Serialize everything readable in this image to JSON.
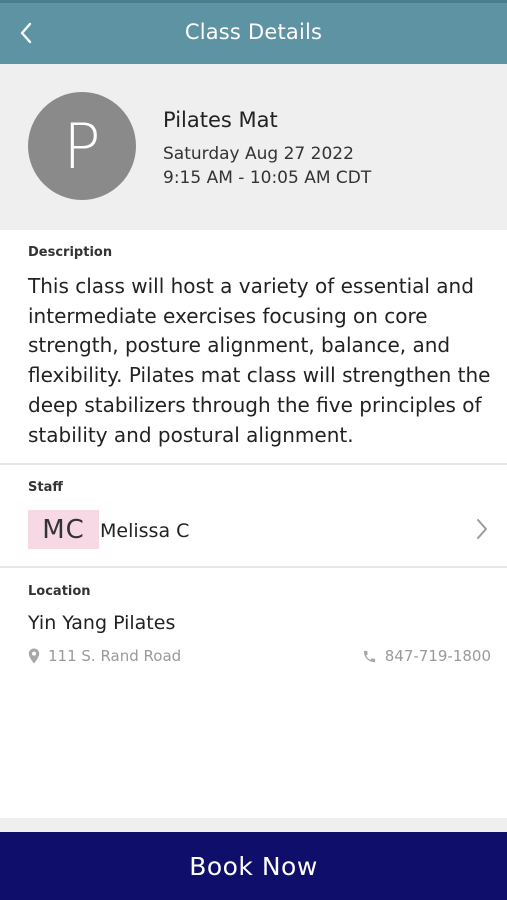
{
  "header": {
    "title": "Class Details",
    "back_icon": "chevron-left-icon"
  },
  "class": {
    "avatar_letter": "P",
    "name": "Pilates Mat",
    "date": "Saturday Aug 27 2022",
    "time": "9:15 AM - 10:05 AM CDT"
  },
  "description": {
    "label": "Description",
    "text": "This class will host a variety of essential and intermediate exercises focusing on core strength, posture alignment, balance, and flexibility. Pilates mat class will strengthen the deep stabilizers through the five principles of stability and postural alignment."
  },
  "staff": {
    "label": "Staff",
    "initials": "MC",
    "name": "Melissa C",
    "chevron_icon": "chevron-right-icon"
  },
  "location": {
    "label": "Location",
    "name": "Yin Yang Pilates",
    "address": "111 S. Rand Road",
    "address_icon": "map-pin-icon",
    "phone": "847-719-1800",
    "phone_icon": "phone-icon"
  },
  "footer": {
    "book_label": "Book Now"
  },
  "colors": {
    "header_bg": "#5e93a3",
    "book_button_bg": "#0f0f6b",
    "avatar_bg": "#8a8a8a",
    "initials_bg": "#f7d9e6"
  }
}
